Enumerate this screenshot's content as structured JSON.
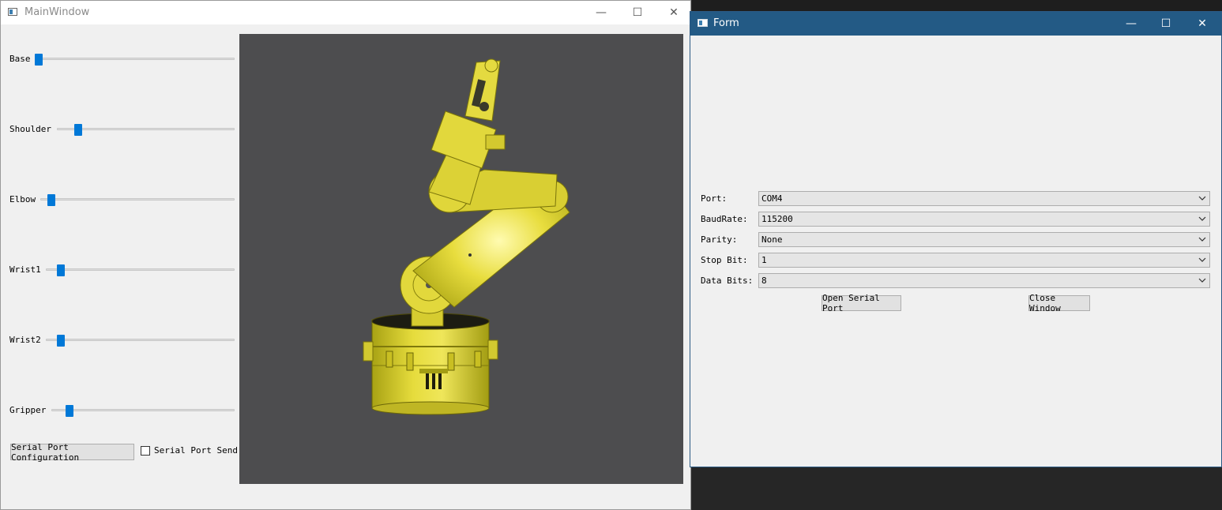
{
  "main_window": {
    "title": "MainWindow",
    "controls": {
      "minimize": "—",
      "maximize": "☐",
      "close": "✕"
    },
    "sliders": [
      {
        "label": "Base",
        "value": 0.0
      },
      {
        "label": "Shoulder",
        "value": 0.1
      },
      {
        "label": "Elbow",
        "value": 0.04
      },
      {
        "label": "Wrist1",
        "value": 0.06
      },
      {
        "label": "Wrist2",
        "value": 0.06
      },
      {
        "label": "Gripper",
        "value": 0.08
      }
    ],
    "serial_config_button": "Serial Port Configuration",
    "serial_send_checkbox": {
      "label": "Serial Port Send",
      "checked": false
    }
  },
  "form_window": {
    "title": "Form",
    "controls": {
      "minimize": "—",
      "maximize": "☐",
      "close": "✕"
    },
    "fields": [
      {
        "label": "Port:",
        "value": "COM4"
      },
      {
        "label": "BaudRate:",
        "value": "115200"
      },
      {
        "label": "Parity:",
        "value": "None"
      },
      {
        "label": "Stop Bit:",
        "value": "1"
      },
      {
        "label": "Data Bits:",
        "value": "8"
      }
    ],
    "open_button": "Open Serial Port",
    "close_button": "Close Window"
  },
  "colors": {
    "slider_handle": "#0078d7",
    "form_titlebar": "#235a85",
    "viewport_bg": "#4d4d4f",
    "robot_yellow": "#e1d838"
  }
}
